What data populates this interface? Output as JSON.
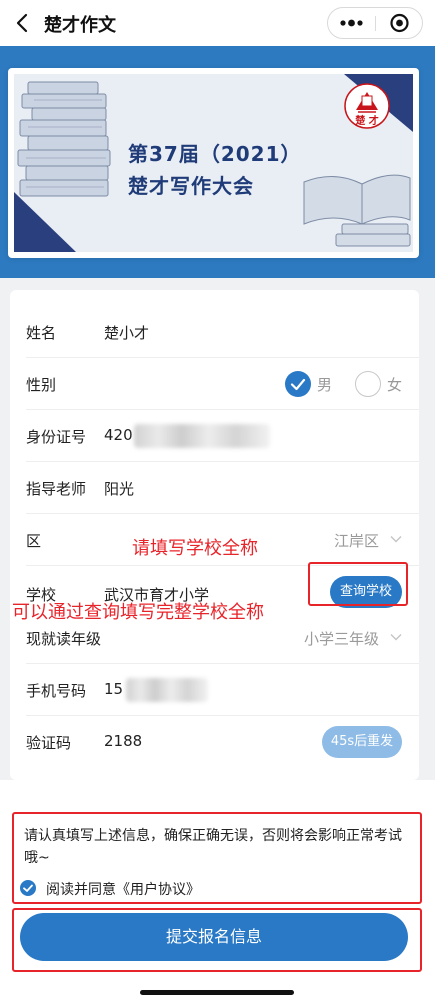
{
  "nav": {
    "title": "楚才作文"
  },
  "banner": {
    "line1": "第37届（2021）",
    "line2": "楚才写作大会",
    "logo_text": "楚  才"
  },
  "form": {
    "name": {
      "label": "姓名",
      "value": "楚小才"
    },
    "gender": {
      "label": "性别",
      "options": [
        "男",
        "女"
      ],
      "selected": "男"
    },
    "id_number": {
      "label": "身份证号",
      "value_prefix": "420"
    },
    "teacher": {
      "label": "指导老师",
      "value": "阳光"
    },
    "district": {
      "label": "区",
      "value": "江岸区"
    },
    "school": {
      "label": "学校",
      "value": "武汉市育才小学",
      "query_button": "查询学校"
    },
    "grade": {
      "label": "现就读年级",
      "value": "小学三年级"
    },
    "phone": {
      "label": "手机号码",
      "value_prefix": "15"
    },
    "code": {
      "label": "验证码",
      "value": "2188",
      "resend_button": "45s后重发"
    }
  },
  "annotations": {
    "school_full_name": "请填写学校全称",
    "query_hint": "可以通过查询填写完整学校全称"
  },
  "agreement": {
    "notice": "请认真填写上述信息，确保正确无误，否则将会影响正常考试哦~",
    "agree_prefix": "阅读并同意",
    "agree_link": "《用户协议》",
    "checked": true
  },
  "submit": {
    "label": "提交报名信息"
  },
  "colors": {
    "primary": "#2979c6",
    "annotation": "#e8242b",
    "banner_title": "#1f3b78"
  }
}
